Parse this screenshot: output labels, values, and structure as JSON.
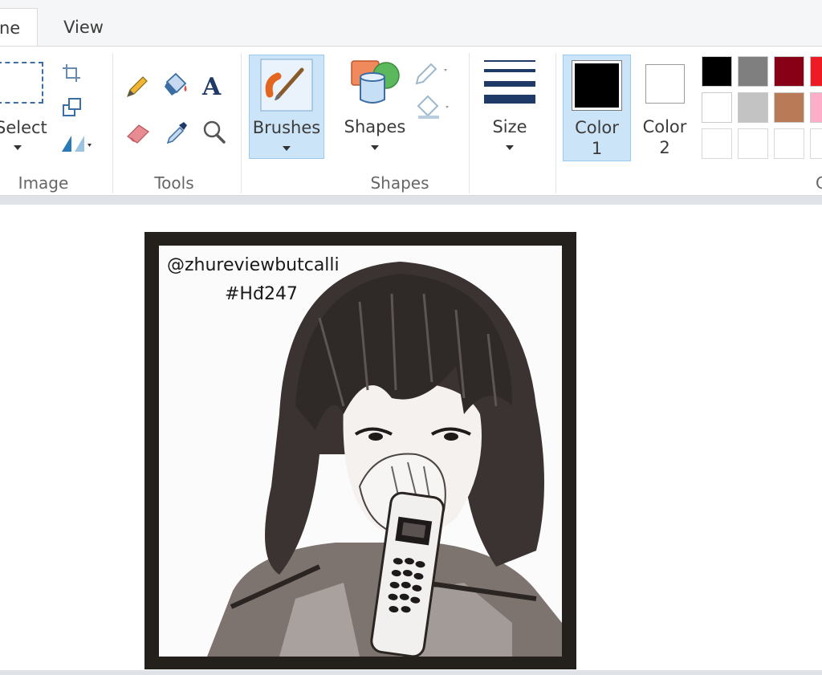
{
  "tabs": [
    {
      "label": "ne"
    },
    {
      "label": "View"
    }
  ],
  "ribbon": {
    "groups": {
      "image": "Image",
      "tools": "Tools",
      "shapes": "Shapes"
    },
    "commands": {
      "select": "Select",
      "brushes": "Brushes",
      "shapes": "Shapes",
      "size": "Size",
      "color1_line1": "Color",
      "color1_line2": "1",
      "color2_line1": "Color",
      "color2_line2": "2"
    },
    "colors_group_partial": "C",
    "palette": {
      "row1": [
        "#000000",
        "#7f7f7f",
        "#880015",
        "#ed1c24"
      ],
      "row2": [
        "#ffffff",
        "#c3c3c3",
        "#b97a57",
        "#ffaec9"
      ],
      "row3": [
        "#ffffff",
        "#ffffff",
        "#ffffff",
        "#ffffff"
      ]
    },
    "color1": "#000000",
    "color2": "#ffffff",
    "accent": "#cce4f7"
  },
  "canvas": {
    "watermark_line1": "@zhureviewbutcalli",
    "watermark_line2": "#Hđ247"
  }
}
